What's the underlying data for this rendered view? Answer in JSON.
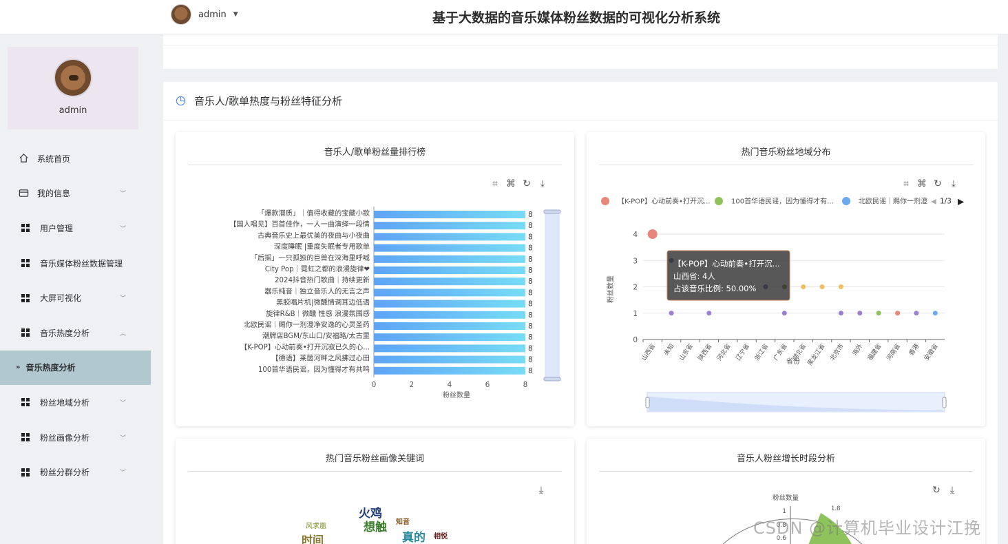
{
  "header": {
    "username": "admin",
    "title": "基于大数据的音乐媒体粉丝数据的可视化分析系统"
  },
  "sidebar": {
    "profile_name": "admin",
    "items": [
      {
        "label": "系统首页"
      },
      {
        "label": "我的信息"
      },
      {
        "label": "用户管理"
      },
      {
        "label": "音乐媒体粉丝数据管理"
      },
      {
        "label": "大屏可视化"
      },
      {
        "label": "音乐热度分析"
      },
      {
        "label": "音乐热度分析"
      },
      {
        "label": "粉丝地域分析"
      },
      {
        "label": "粉丝画像分析"
      },
      {
        "label": "粉丝分群分析"
      }
    ]
  },
  "panel": {
    "title": "音乐人/歌单热度与粉丝特征分析"
  },
  "cards": {
    "ranking": {
      "title": "音乐人/歌单粉丝量排行榜"
    },
    "region": {
      "title": "热门音乐粉丝地域分布"
    },
    "keywords": {
      "title": "热门音乐粉丝画像关键词"
    },
    "growth": {
      "title": "音乐人粉丝增长时段分析"
    }
  },
  "chart_data": [
    {
      "type": "bar",
      "orientation": "horizontal",
      "title": "音乐人/歌单粉丝量排行榜",
      "xlabel": "粉丝数量",
      "xlim": [
        0,
        8
      ],
      "xticks": [
        "0",
        "2",
        "4",
        "6",
        "8"
      ],
      "categories": [
        "「爆款潜质」｜值得收藏的宝藏小歌",
        "【国人唱见】百首佳作，一人一曲演绎一段情",
        "古典音乐史上最优美的夜曲与小夜曲",
        "深度睡眠 |重度失眠者专用歌单",
        "「后摇」一只孤独的巨兽在深海里呼喊",
        "City Pop｜霓虹之都的浪漫旋律❤",
        "2024抖音热门歌曲｜持续更新",
        "器乐纯音｜独立音乐人的无言之声",
        "黑胶唱片机|微醺情调耳边低语",
        "旋律R&B｜微醺 性感 浪漫氛围感",
        "北欧民谣｜赐你一剂澄净安逸的心灵圣药",
        "潮牌店BGM/东山口/安福路/太古里",
        "【K-POP】心动前奏•打开沉寂已久的心...",
        "【德语】莱茵河畔之风拂过心田",
        "100首华语民谣，因为懂得才有共鸣"
      ],
      "values": [
        8,
        8,
        8,
        8,
        8,
        8,
        8,
        8,
        8,
        8,
        8,
        8,
        8,
        8,
        8
      ]
    },
    {
      "type": "scatter",
      "title": "热门音乐粉丝地域分布",
      "xlabel": "省份",
      "ylabel": "粉丝数量",
      "ylim": [
        0,
        4
      ],
      "yticks": [
        "0",
        "1",
        "2",
        "3",
        "4"
      ],
      "legend_position": "top",
      "legend_page": "1/3",
      "legend": [
        {
          "name": "【K-POP】心动前奏•打开沉...",
          "color": "#e8867a"
        },
        {
          "name": "100首华语民谣，因为懂得才有...",
          "color": "#8dc35a"
        },
        {
          "name": "北欧民谣｜赐你一剂澄",
          "color": "#6aaaf0"
        }
      ],
      "categories": [
        "山西省",
        "未知",
        "山东省",
        "陕西省",
        "河北省",
        "辽宁省",
        "浙江省",
        "广东省",
        "湖北省",
        "黑龙江省",
        "北京市",
        "海外",
        "福建省",
        "河南省",
        "香港",
        "安徽省"
      ],
      "points": [
        {
          "x": "山西省",
          "y": 4,
          "color": "#e8867a",
          "size": 14
        },
        {
          "x": "未知",
          "y": 3,
          "color": "#2c3a77",
          "size": 7
        },
        {
          "x": "未知",
          "y": 1,
          "color": "#9b7fd0",
          "size": 7
        },
        {
          "x": "陕西省",
          "y": 1,
          "color": "#9b7fd0",
          "size": 7
        },
        {
          "x": "浙江省",
          "y": 2,
          "color": "#2c3a77",
          "size": 7
        },
        {
          "x": "广东省",
          "y": 2,
          "color": "#5a5a20",
          "size": 7
        },
        {
          "x": "广东省",
          "y": 1,
          "color": "#9b7fd0",
          "size": 7
        },
        {
          "x": "湖北省",
          "y": 2,
          "color": "#f0c060",
          "size": 7
        },
        {
          "x": "黑龙江省",
          "y": 2,
          "color": "#f0c060",
          "size": 7
        },
        {
          "x": "北京市",
          "y": 2,
          "color": "#f0c060",
          "size": 7
        },
        {
          "x": "北京市",
          "y": 1,
          "color": "#9b7fd0",
          "size": 7
        },
        {
          "x": "海外",
          "y": 1,
          "color": "#9b7fd0",
          "size": 7
        },
        {
          "x": "福建省",
          "y": 1,
          "color": "#8dc35a",
          "size": 7
        },
        {
          "x": "河南省",
          "y": 1,
          "color": "#e8867a",
          "size": 7
        },
        {
          "x": "香港",
          "y": 1,
          "color": "#9b7fd0",
          "size": 7
        },
        {
          "x": "安徽省",
          "y": 1,
          "color": "#6aaaf0",
          "size": 7
        }
      ],
      "tooltip": {
        "title": "【K-POP】心动前奏•打开沉...",
        "line1": "山西省: 4人",
        "line2": "占该音乐比例: 50.00%"
      }
    },
    {
      "type": "other",
      "title": "热门音乐粉丝画像关键词",
      "words": [
        {
          "text": "火鸡",
          "color": "#1f3d7a"
        },
        {
          "text": "想触",
          "color": "#3a7d2a"
        },
        {
          "text": "风求凰",
          "color": "#7a8a20"
        },
        {
          "text": "知音",
          "color": "#8a5a20"
        },
        {
          "text": "真的",
          "color": "#2a8aa0"
        },
        {
          "text": "时间",
          "color": "#8a7a30"
        },
        {
          "text": "相悦",
          "color": "#6a2020"
        }
      ]
    },
    {
      "type": "other",
      "title": "音乐人粉丝增长时段分析",
      "ylabel": "粉丝数量",
      "ticks": [
        "1",
        "0.8",
        "0.6"
      ],
      "ring_label": "1.8"
    }
  ],
  "watermark": "CSDN @计算机毕业设计江挽"
}
